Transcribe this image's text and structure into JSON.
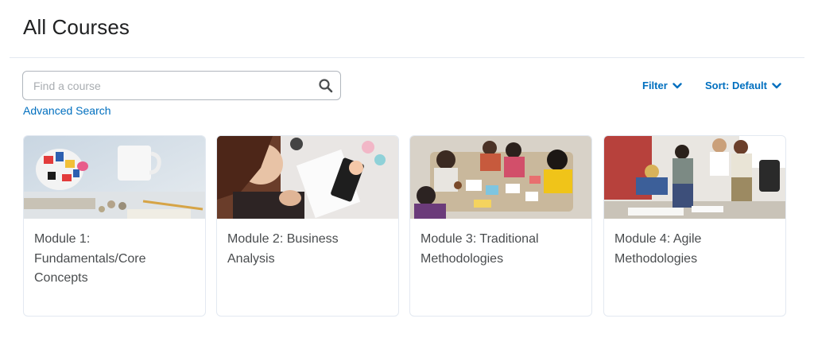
{
  "page": {
    "title": "All Courses"
  },
  "search": {
    "placeholder": "Find a course",
    "value": "",
    "advanced_label": "Advanced Search"
  },
  "controls": {
    "filter_label": "Filter",
    "sort_label": "Sort: Default"
  },
  "colors": {
    "accent": "#006fbf",
    "text": "#494c4e",
    "border": "#e3e9f1"
  },
  "courses": [
    {
      "title": "Module 1: Fundamentals/Core Concepts",
      "image": "piggy-bank-photo"
    },
    {
      "title": "Module 2: Business Analysis",
      "image": "person-writing-photo"
    },
    {
      "title": "Module 3: Traditional Methodologies",
      "image": "team-meeting-photo"
    },
    {
      "title": "Module 4: Agile Methodologies",
      "image": "office-team-photo"
    }
  ]
}
